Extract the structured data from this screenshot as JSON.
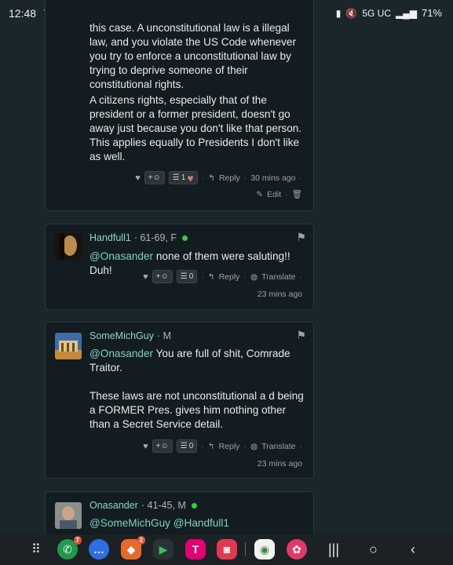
{
  "status_bar": {
    "time": "12:48",
    "network": "5G UC",
    "battery": "71%"
  },
  "comment_top": {
    "paragraph1": "this case. A unconstitutional law is a illegal law, and you violate the US Code whenever you try to enforce a unconstitutional law by trying to deprive someone of their constitutional rights.",
    "paragraph2": "A citizens rights, especially that of the president or a former president, doesn't go away just because you don't like that person. This applies equally to Presidents I don't like as well.",
    "react_label": "+☺",
    "list_count": "1",
    "reply": "Reply",
    "time_ago": "30 mins ago",
    "edit": "Edit"
  },
  "comment_handfull": {
    "username": "Handfull1",
    "user_meta": "· 61-69, F",
    "mention": "@Onasander",
    "text": " none of them were saluting!! Duh!",
    "react_label": "+☺",
    "list_count": "0",
    "reply": "Reply",
    "translate": "Translate",
    "time_ago": "23 mins ago"
  },
  "comment_michguy": {
    "username": "SomeMichGuy",
    "user_meta": "· M",
    "mention": "@Onasander",
    "text1": " You are full of shit, Comrade Traitor.",
    "text2": "These laws are not unconstitutional a d being a FORMER Pres. gives him nothing other than a Secret Service detail.",
    "react_label": "+☺",
    "list_count": "0",
    "reply": "Reply",
    "translate": "Translate",
    "time_ago": "23 mins ago"
  },
  "comment_onasander": {
    "username": "Onasander",
    "user_meta": "· 41-45, M",
    "mention1": "@SomeMichGuy",
    "mention2": "@Handfull1"
  },
  "nav_bar": {
    "phone_badge": "7",
    "brave_badge": "2"
  }
}
